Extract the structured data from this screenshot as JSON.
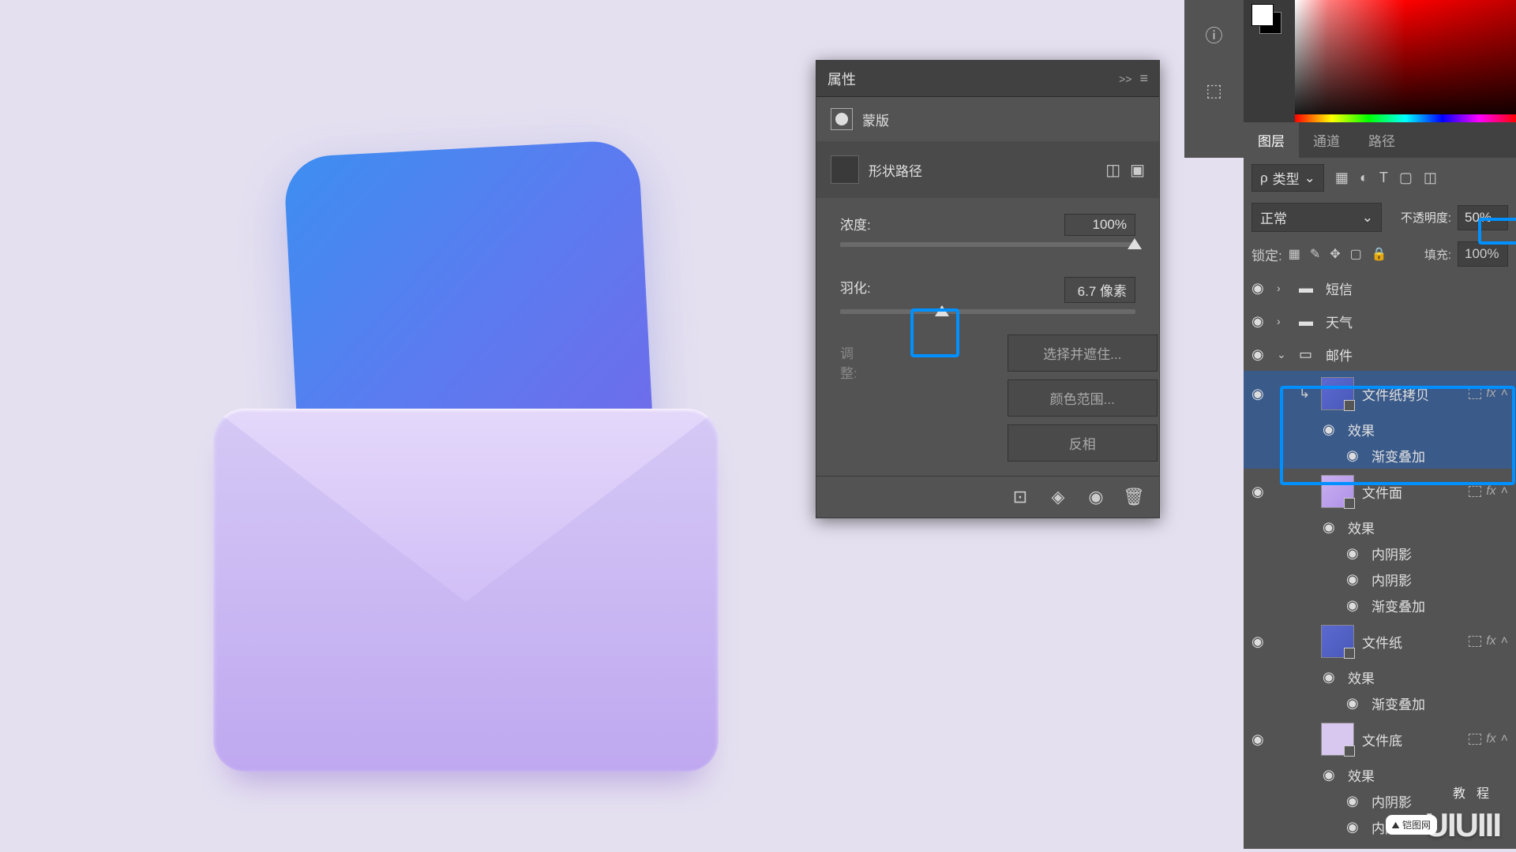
{
  "properties_panel": {
    "title": "属性",
    "mask_label": "蒙版",
    "shape_path_label": "形状路径",
    "density_label": "浓度:",
    "density_value": "100%",
    "feather_label": "羽化:",
    "feather_value": "6.7 像素",
    "adjust_label": "调整:",
    "btn_select": "选择并遮住...",
    "btn_color_range": "颜色范围...",
    "btn_invert": "反相"
  },
  "layers_panel": {
    "tabs": {
      "layers": "图层",
      "channels": "通道",
      "paths": "路径"
    },
    "filter_type": "类型",
    "blend_mode": "正常",
    "opacity_label": "不透明度:",
    "opacity_value": "50%",
    "lock_label": "锁定:",
    "fill_label": "填充:",
    "fill_value": "100%",
    "layers": {
      "sms": "短信",
      "weather": "天气",
      "mail": "邮件",
      "paper_copy": "文件纸拷贝",
      "effects": "效果",
      "grad_overlay": "渐变叠加",
      "file_face": "文件面",
      "inner_shadow": "内阴影",
      "file_paper": "文件纸",
      "file_bottom": "文件底"
    }
  },
  "watermark": {
    "main": "UIUIII",
    "sub": "教程",
    "logo": "铠图网"
  },
  "icons": {
    "search": "🔍",
    "eye": "◉",
    "folder": "📁",
    "arrow_right": "›",
    "arrow_down": "⌄"
  },
  "chart_data": null
}
